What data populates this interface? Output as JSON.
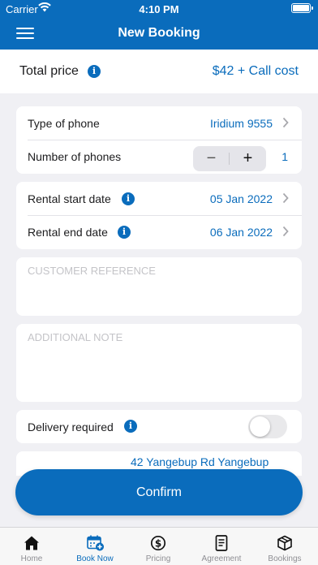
{
  "status_bar": {
    "carrier": "Carrier",
    "time": "4:10 PM"
  },
  "header": {
    "title": "New Booking"
  },
  "total": {
    "label": "Total price",
    "value": "$42 + Call cost"
  },
  "phone_card": {
    "type_label": "Type of phone",
    "type_value": "Iridium 9555",
    "number_label": "Number of phones",
    "minus": "−",
    "plus": "+",
    "quantity": "1"
  },
  "dates_card": {
    "start_label": "Rental start date",
    "start_value": "05 Jan 2022",
    "end_label": "Rental end date",
    "end_value": "06 Jan 2022"
  },
  "customer_reference": {
    "placeholder": "CUSTOMER REFERENCE",
    "value": ""
  },
  "additional_note": {
    "placeholder": "ADDITIONAL NOTE",
    "value": ""
  },
  "delivery": {
    "label": "Delivery required",
    "enabled": false
  },
  "address": {
    "value": "42 Yangebup Rd Yangebup"
  },
  "confirm": {
    "label": "Confirm"
  },
  "tabs": [
    {
      "label": "Home",
      "icon": "home-icon"
    },
    {
      "label": "Book Now",
      "icon": "calendar-add-icon"
    },
    {
      "label": "Pricing",
      "icon": "dollar-circle-icon"
    },
    {
      "label": "Agreement",
      "icon": "document-icon"
    },
    {
      "label": "Bookings",
      "icon": "box-icon"
    }
  ],
  "colors": {
    "accent": "#0a6cbc",
    "background": "#f0f0f4"
  }
}
